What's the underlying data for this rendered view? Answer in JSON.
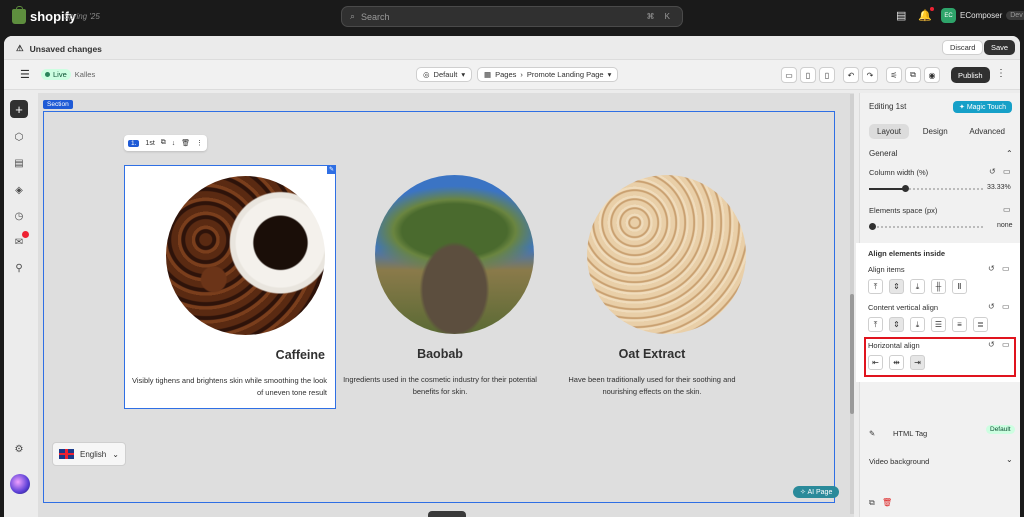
{
  "topbar": {
    "brand": "shopify",
    "edition": "Spring '25",
    "search_placeholder": "Search",
    "search_kbd": "⌘ K",
    "app_name": "EComposer",
    "app_badge": "Dev",
    "app_avatar": "EC"
  },
  "unsaved": {
    "title": "Unsaved changes",
    "discard": "Discard",
    "save": "Save"
  },
  "toolbar": {
    "live": "Live",
    "theme": "Kalles",
    "template": "Default",
    "pages": "Pages",
    "page_name": "Promote Landing Page",
    "publish": "Publish"
  },
  "canvas": {
    "section_label": "Section",
    "el_number": "1.",
    "el_label": "1st",
    "columns": [
      {
        "title": "Caffeine",
        "text": "Visibly tighens and brightens skin while smoothing the look of uneven tone result"
      },
      {
        "title": "Baobab",
        "text": "Ingredients used in the cosmetic industry for their potential benefits for skin."
      },
      {
        "title": "Oat Extract",
        "text": "Have been traditionally used for their soothing and nourishing effects on the skin."
      }
    ],
    "language": "English",
    "ai_page": "AI Page"
  },
  "panel": {
    "editing": "Editing 1st",
    "magic": "Magic Touch",
    "tabs": [
      "Layout",
      "Design",
      "Advanced"
    ],
    "general": "General",
    "column_width_label": "Column width (%)",
    "column_width_value": "33.33%",
    "column_width_fraction": 0.33,
    "elements_space_label": "Elements space (px)",
    "elements_space_value": "none",
    "align_heading": "Align elements inside",
    "align_items": "Align items",
    "content_vertical": "Content vertical align",
    "horizontal_align": "Horizontal align",
    "html_tag": "HTML Tag",
    "html_tag_value": "Default",
    "video_bg": "Video background"
  },
  "colors": {
    "accent": "#2f6fe4",
    "highlight": "#e0141e",
    "live": "#29845a"
  }
}
